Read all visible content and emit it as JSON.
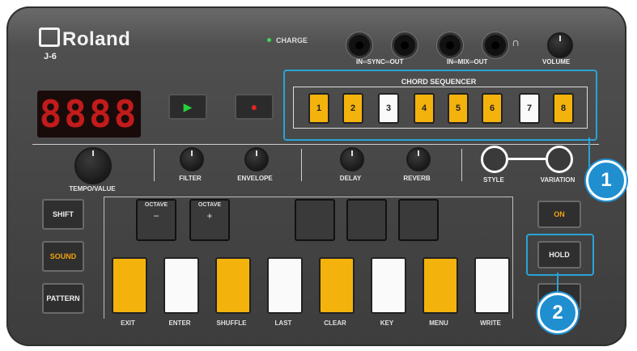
{
  "brand": {
    "logo": "Roland",
    "model": "J-6"
  },
  "status": {
    "charge_label": "CHARGE"
  },
  "jacks": {
    "sync_label": "IN═SYNC═OUT",
    "mix_label": "IN═MIX═OUT",
    "volume_label": "VOLUME"
  },
  "display": {
    "value": "8888"
  },
  "knobs": {
    "tempo": "TEMPO/VALUE",
    "filter": "FILTER",
    "envelope": "ENVELOPE",
    "delay": "DELAY",
    "reverb": "REVERB",
    "style": "STYLE",
    "variation": "VARIATION"
  },
  "chord_sequencer": {
    "title": "CHORD SEQUENCER",
    "keys": [
      {
        "label": "1",
        "color": "#f4b30c"
      },
      {
        "label": "2",
        "color": "#f4b30c"
      },
      {
        "label": "3",
        "color": "#fafafa"
      },
      {
        "label": "4",
        "color": "#f4b30c"
      },
      {
        "label": "5",
        "color": "#f4b30c"
      },
      {
        "label": "6",
        "color": "#f4b30c"
      },
      {
        "label": "7",
        "color": "#fafafa"
      },
      {
        "label": "8",
        "color": "#f4b30c"
      }
    ]
  },
  "left_buttons": {
    "shift": "SHIFT",
    "sound": "SOUND",
    "pattern": "PATTERN"
  },
  "octave": {
    "label": "OCTAVE",
    "minus": "−",
    "plus": "+"
  },
  "pads": {
    "labels": [
      "EXIT",
      "ENTER",
      "SHUFFLE",
      "LAST",
      "CLEAR",
      "KEY",
      "MENU",
      "WRITE"
    ]
  },
  "right_buttons": {
    "on": "ON",
    "hold": "HOLD"
  },
  "callouts": {
    "one": "1",
    "two": "2"
  },
  "colors": {
    "accent": "#2aa3d6",
    "pad_yellow": "#f4b30c",
    "pad_white": "#fafafa",
    "display_red": "#c21b1b"
  }
}
